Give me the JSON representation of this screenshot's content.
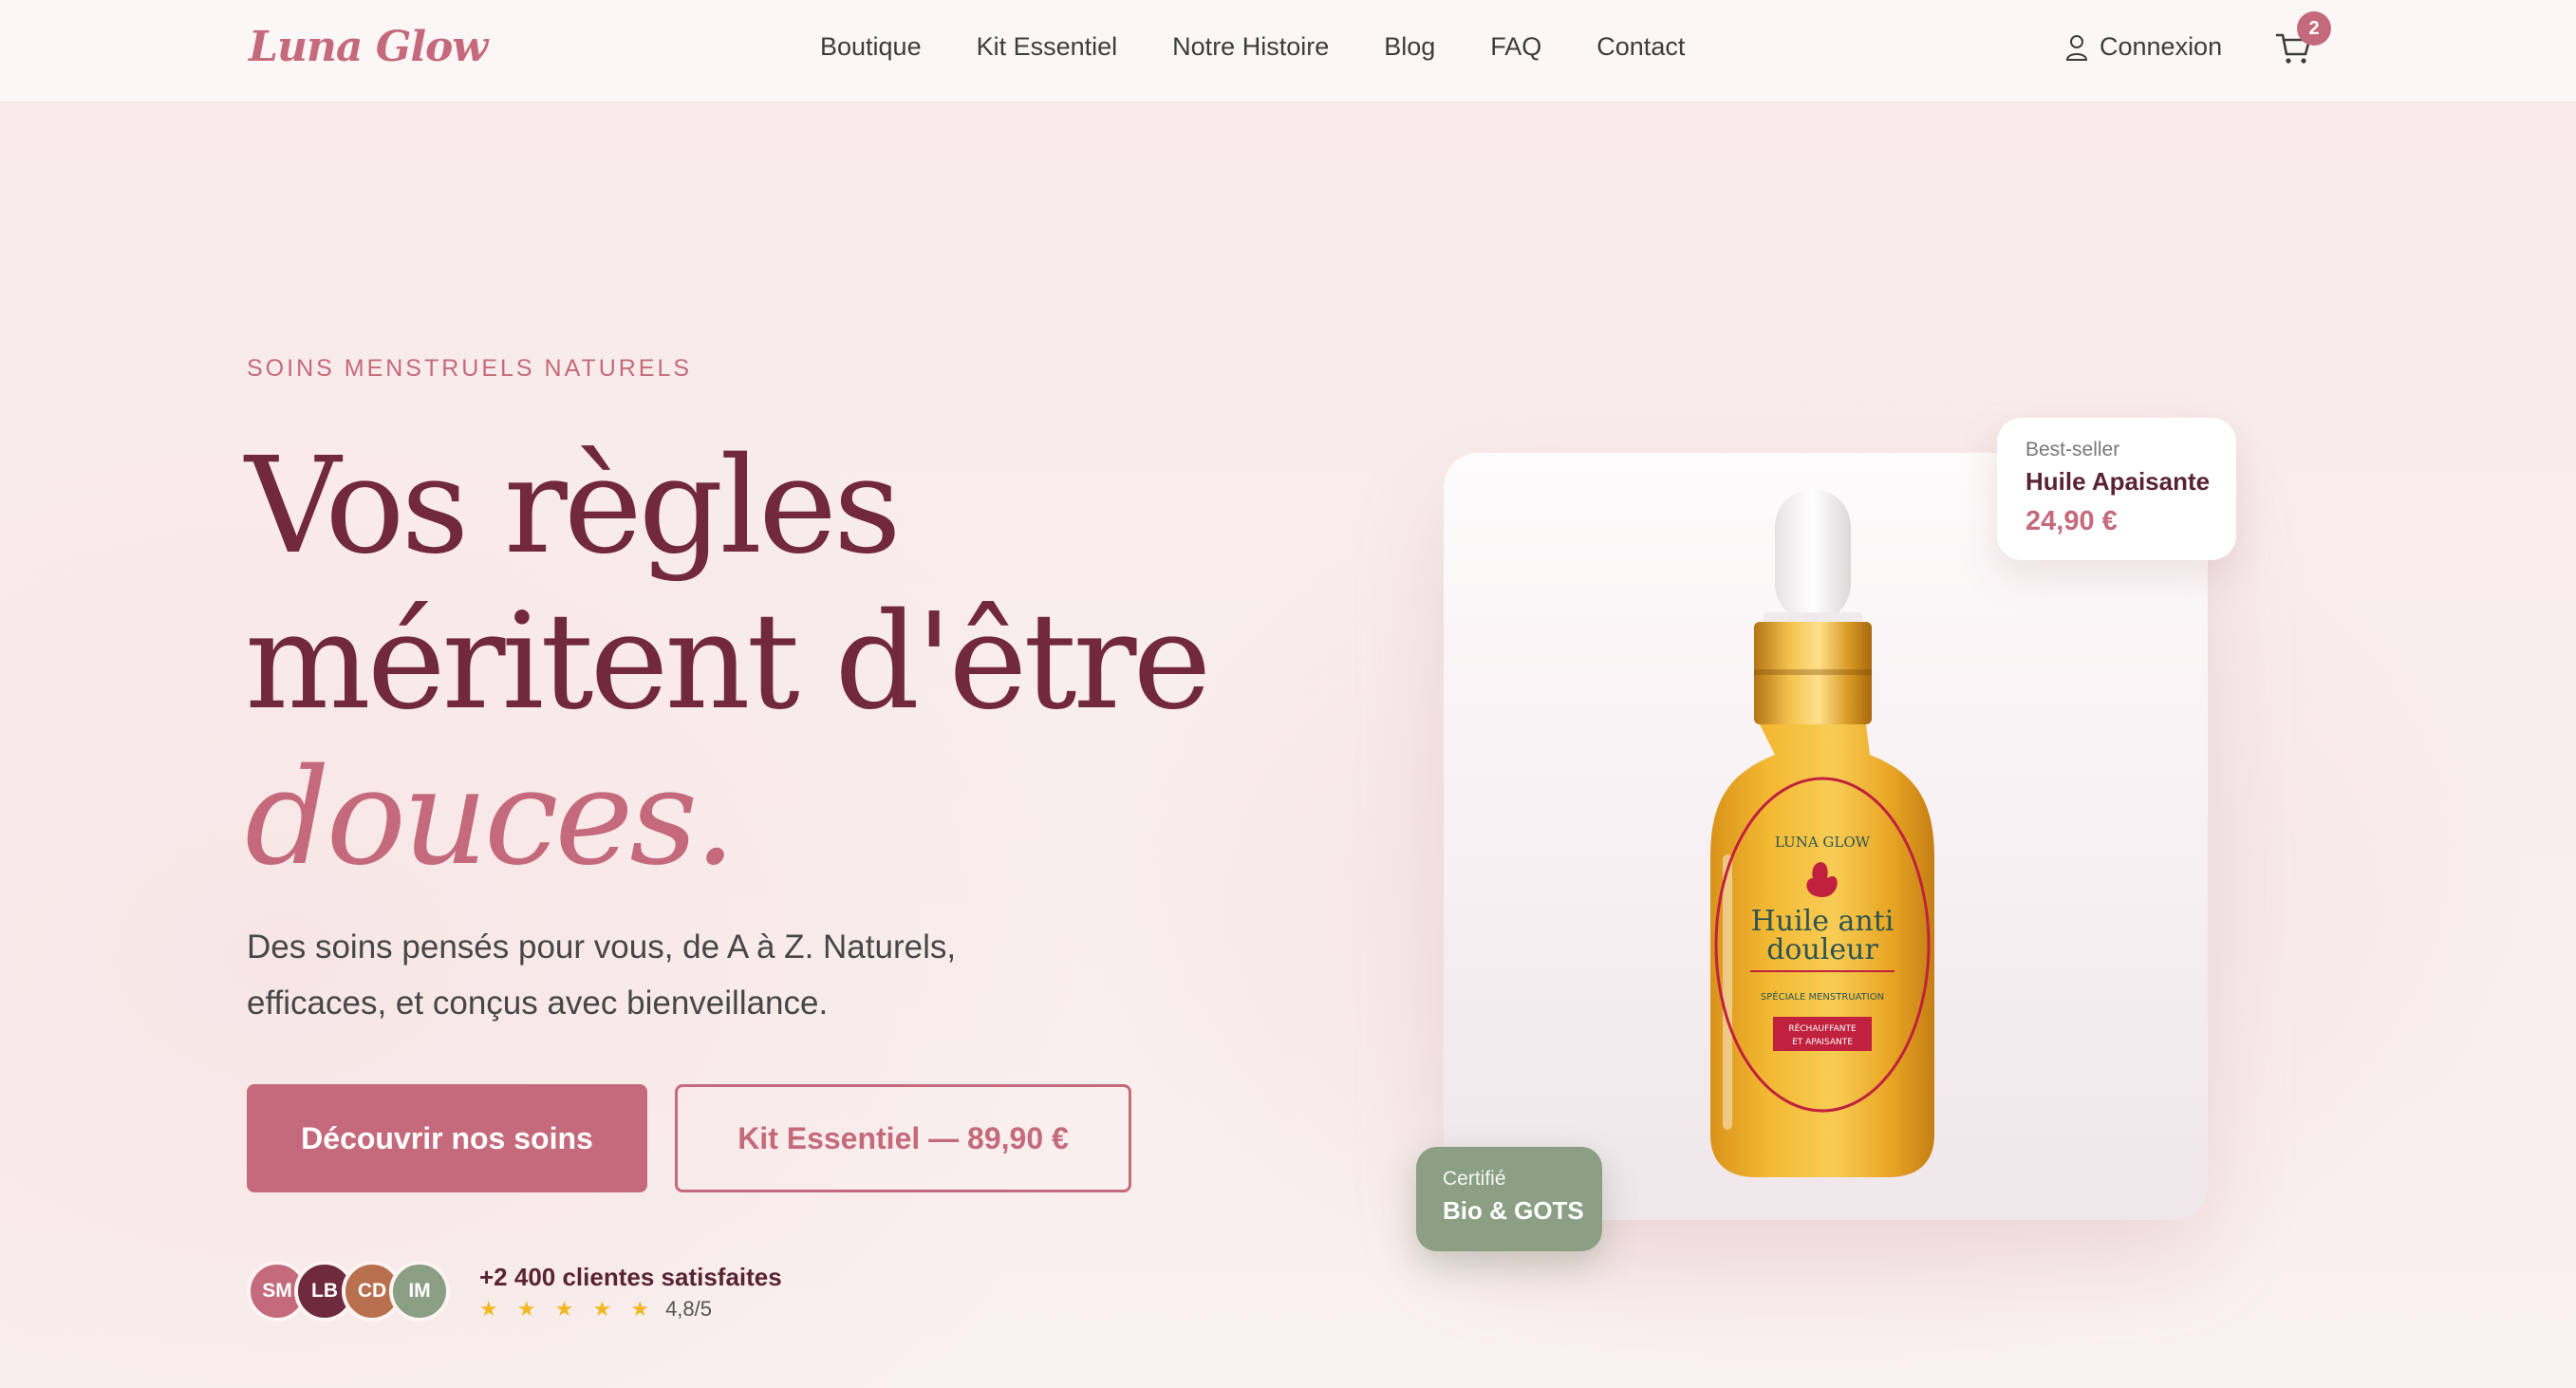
{
  "brand": {
    "logo": "Luna Glow"
  },
  "nav": {
    "items": [
      "Boutique",
      "Kit Essentiel",
      "Notre Histoire",
      "Blog",
      "FAQ",
      "Contact"
    ],
    "login": "Connexion",
    "cart_count": "2"
  },
  "hero": {
    "eyebrow": "SOINS MENSTRUELS NATURELS",
    "title_line1": "Vos règles",
    "title_line2": "méritent d'être",
    "title_accent": "douces.",
    "lead_line1": "Des soins pensés pour vous, de A à Z. Naturels,",
    "lead_line2": "efficaces, et conçus avec bienveillance.",
    "cta_primary": "Découvrir nos soins",
    "cta_secondary": "Kit Essentiel — 89,90 €",
    "avatars": [
      "SM",
      "LB",
      "CD",
      "IM"
    ],
    "proof_title": "+2 400 clientes satisfaites",
    "stars": "★ ★ ★ ★ ★",
    "rating": "4,8/5",
    "rating_value": 4.8
  },
  "product": {
    "best_label": "Best-seller",
    "name": "Huile Apaisante",
    "price": "24,90 €",
    "label_brand": "LUNA GLOW",
    "label_title_1": "Huile anti",
    "label_title_2": "douleur",
    "label_sub": "SPÉCIALE MENSTRUATION",
    "label_tag_1": "RÉCHAUFFANTE",
    "label_tag_2": "ET APAISANTE",
    "cert_label": "Certifié",
    "cert_value": "Bio & GOTS"
  },
  "colors": {
    "brand": "#c56a7c",
    "title": "#72283d",
    "sage": "#8b9f84",
    "star": "#f2b824",
    "avatar_colors": [
      "#c56a7c",
      "#6e2a3f",
      "#b8704f",
      "#8b9f84"
    ]
  },
  "icons": {
    "login": "user-icon",
    "cart": "cart-icon"
  }
}
